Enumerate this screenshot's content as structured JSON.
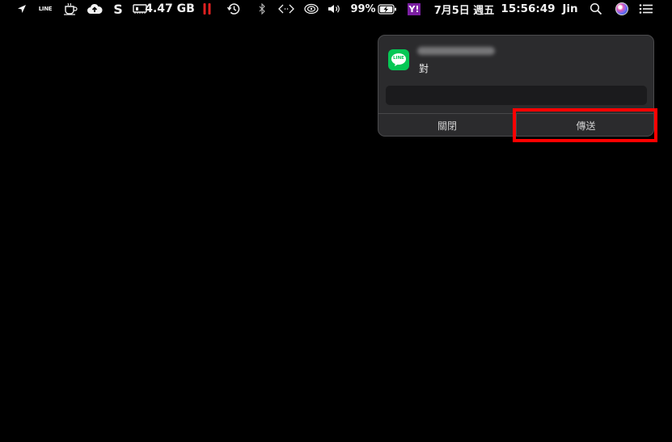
{
  "menubar": {
    "line_label": "LINE",
    "s_label": "S",
    "memory": "4.47 GB",
    "battery_percent": "99%",
    "date": "7月5日 週五",
    "time": "15:56:49",
    "user": "Jin"
  },
  "notification": {
    "app_icon_label": "LINE",
    "message": "對",
    "reply_value": "",
    "buttons": {
      "close": "關閉",
      "send": "傳送"
    }
  },
  "colors": {
    "highlight": "#ff0000",
    "line_green": "#06c755"
  }
}
